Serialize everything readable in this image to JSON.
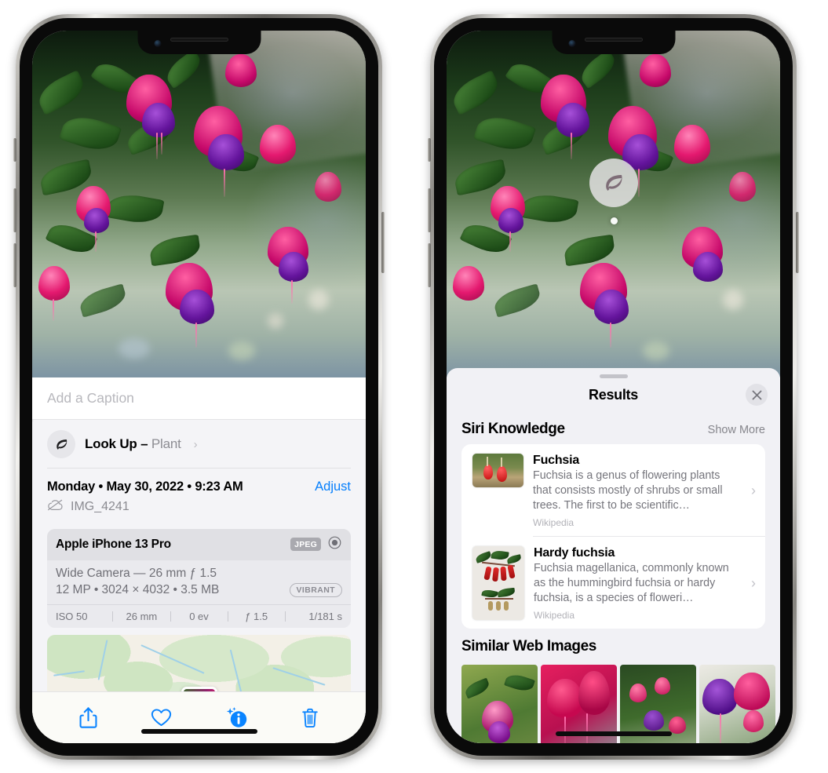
{
  "left_phone": {
    "name": "photos-detail-view",
    "caption_field": {
      "placeholder": "Add a Caption",
      "value": ""
    },
    "lookup_row": {
      "label": "Look Up – ",
      "subject": "Plant",
      "chevron": "›"
    },
    "date_row": {
      "date": "Monday • May 30, 2022 • 9:23 AM",
      "adjust": "Adjust"
    },
    "file_row": {
      "filename": "IMG_4241"
    },
    "camera_card": {
      "model": "Apple iPhone 13 Pro",
      "format_tag": "JPEG",
      "lens_line": "Wide Camera — 26 mm ƒ 1.5",
      "size_line": "12 MP • 3024 × 4032 • 3.5 MB",
      "style_tag": "VIBRANT",
      "exif": [
        "ISO 50",
        "26 mm",
        "0 ev",
        "ƒ 1.5",
        "1/181 s"
      ]
    },
    "toolbar": {
      "share": "share-icon",
      "favorite": "heart-icon",
      "info": "info-sparkle-icon",
      "delete": "trash-icon"
    }
  },
  "right_phone": {
    "name": "visual-look-up-results",
    "visual_lookup_badge": "leaf-icon",
    "sheet": {
      "title": "Results",
      "close": "✕",
      "sections": [
        {
          "title": "Siri Knowledge",
          "action": "Show More",
          "items": [
            {
              "title": "Fuchsia",
              "description": "Fuchsia is a genus of flowering plants that consists mostly of shrubs or small trees. The first to be scientific…",
              "source": "Wikipedia",
              "chevron": "›"
            },
            {
              "title": "Hardy fuchsia",
              "description": "Fuchsia magellanica, commonly known as the hummingbird fuchsia or hardy fuchsia, is a species of floweri…",
              "source": "Wikipedia",
              "chevron": "›"
            }
          ]
        },
        {
          "title": "Similar Web Images",
          "action": "",
          "tiles": [
            "web-image-1",
            "web-image-2",
            "web-image-3",
            "web-image-4"
          ]
        }
      ]
    }
  },
  "colors": {
    "accent_blue": "#0a84ff",
    "sheet_bg": "#f1f1f5",
    "card_bg": "#ffffff",
    "secondary_text": "#75757c"
  }
}
